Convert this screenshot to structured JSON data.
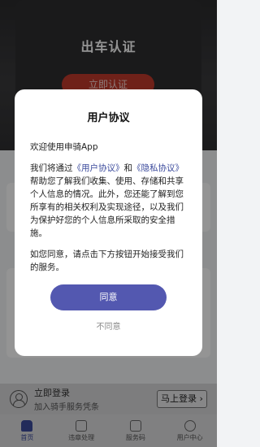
{
  "background": {
    "hero_title": "出车认证",
    "hero_button": "立即认证"
  },
  "login_bar": {
    "title": "立即登录",
    "subtitle": "加入骑手服务凭条",
    "button": "马上登录 ›"
  },
  "tabbar": {
    "items": [
      {
        "label": "首页",
        "active": true
      },
      {
        "label": "违章处理",
        "active": false
      },
      {
        "label": "服务码",
        "active": false
      },
      {
        "label": "用户中心",
        "active": false
      }
    ]
  },
  "modal": {
    "title": "用户协议",
    "welcome": "欢迎使用申骑App",
    "para2_prefix": "我们将通过",
    "link_user_agreement": "《用户协议》",
    "para2_and": "和",
    "link_privacy": "《隐私协议》",
    "para2_suffix": "帮助您了解我们收集、使用、存储和共享个人信息的情况。此外，您还能了解到您所享有的相关权利及实现途径，以及我们为保护好您的个人信息所采取的安全措施。",
    "para3": "如您同意，请点击下方按钮开始接受我们的服务。",
    "agree_button": "同意",
    "disagree_button": "不同意"
  },
  "colors": {
    "accent": "#5358b0",
    "link": "#3b4a9c",
    "hero_button": "#c0392b"
  }
}
